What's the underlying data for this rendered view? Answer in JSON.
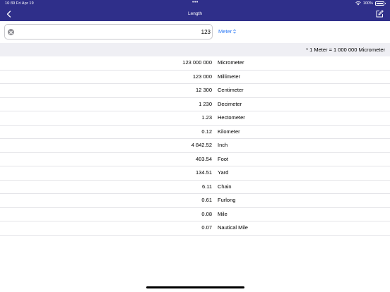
{
  "status_bar": {
    "time_date": "16:39  Fri Apr 19",
    "center_dots": "•••",
    "battery_text": "100%",
    "wifi_icon": "wifi-icon",
    "battery_icon": "battery-icon"
  },
  "nav": {
    "title": "Length",
    "back_icon": "chevron-left-icon",
    "edit_icon": "compose-icon"
  },
  "input": {
    "value": "123",
    "unit": "Meter",
    "clear_icon": "clear-icon",
    "selector_icon": "up-down-chevron-icon"
  },
  "info": {
    "text": "* 1 Meter = 1 000 000 Micrometer"
  },
  "results": [
    {
      "value": "123 000 000",
      "unit": "Micrometer"
    },
    {
      "value": "123 000",
      "unit": "Millimeter"
    },
    {
      "value": "12 300",
      "unit": "Centimeter"
    },
    {
      "value": "1 230",
      "unit": "Decimeter"
    },
    {
      "value": "1.23",
      "unit": "Hectometer"
    },
    {
      "value": "0.12",
      "unit": "Kilometer"
    },
    {
      "value": "4 842.52",
      "unit": "Inch"
    },
    {
      "value": "403.54",
      "unit": "Foot"
    },
    {
      "value": "134.51",
      "unit": "Yard"
    },
    {
      "value": "6.11",
      "unit": "Chain"
    },
    {
      "value": "0.61",
      "unit": "Furlong"
    },
    {
      "value": "0.08",
      "unit": "Mile"
    },
    {
      "value": "0.07",
      "unit": "Nautical Mile"
    }
  ],
  "colors": {
    "nav_background": "#2f2f8a",
    "accent": "#2f7bf5",
    "info_background": "#efeff4"
  }
}
